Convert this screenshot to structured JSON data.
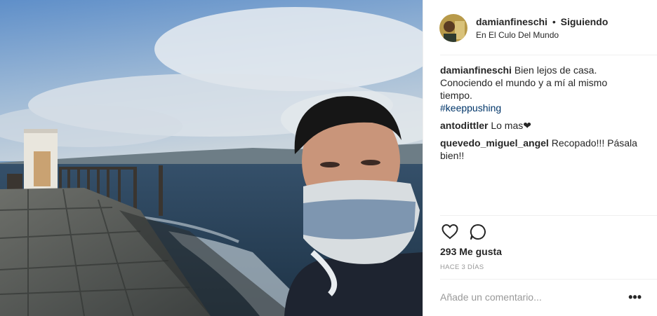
{
  "header": {
    "username": "damianfineschi",
    "separator": "•",
    "follow_status": "Siguiendo",
    "location": "En El Culo Del Mundo"
  },
  "caption": {
    "username": "damianfineschi",
    "line1": "Bien lejos de casa.",
    "line2": "Conociendo el mundo y a mí al mismo",
    "line3": "tiempo.",
    "hashtag": "#keeppushing"
  },
  "comments": [
    {
      "username": "antodittler",
      "text": "Lo mas❤"
    },
    {
      "username": "quevedo_miguel_angel",
      "text": "Recopado!!! Pásala bien!!"
    }
  ],
  "actions": {
    "like_icon": "heart-icon",
    "comment_icon": "comment-bubble-icon"
  },
  "likes": "293 Me gusta",
  "timestamp": "HACE 3 DÍAS",
  "add_comment_placeholder": "Añade un comentario...",
  "more_options": "•••",
  "colors": {
    "hashtag": "#003569",
    "text": "#262626",
    "muted": "#999999",
    "divider": "#efefef"
  }
}
